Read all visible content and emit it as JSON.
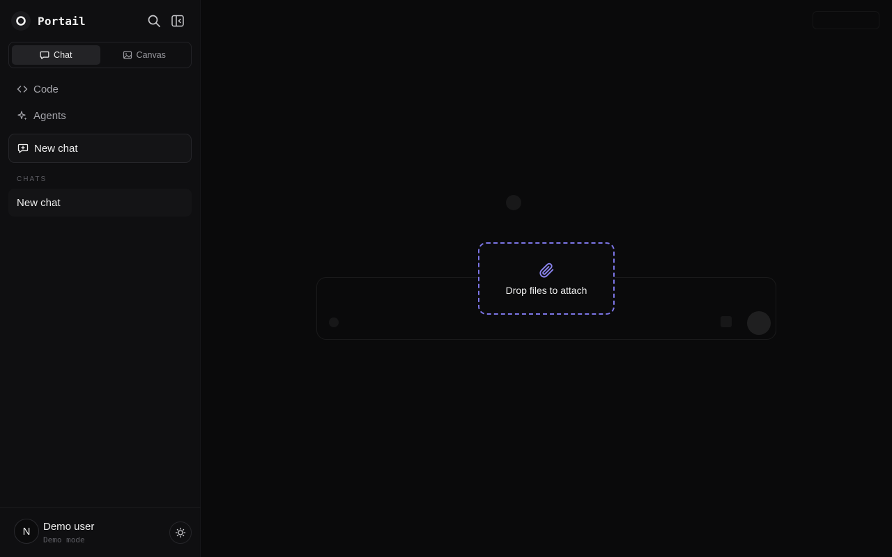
{
  "brand": {
    "name": "Portail"
  },
  "sidebar": {
    "icons": {
      "search": "search-icon",
      "collapse": "sidebar-collapse-icon"
    },
    "modes": [
      {
        "label": "Chat",
        "icon": "message-square-icon",
        "active": true
      },
      {
        "label": "Canvas",
        "icon": "image-icon",
        "active": false
      }
    ],
    "nav": [
      {
        "label": "Code",
        "icon": "code-icon"
      },
      {
        "label": "Agents",
        "icon": "sparkles-icon"
      }
    ],
    "new_chat_label": "New chat",
    "chats_section": "CHATS",
    "chats": [
      {
        "title": "New chat"
      }
    ],
    "user": {
      "initial": "N",
      "name": "Demo user",
      "subtitle": "Demo mode"
    },
    "theme_icon": "sun-icon"
  },
  "main": {
    "drop_overlay": {
      "label": "Drop files to attach",
      "icon": "paperclip-icon",
      "accent": "#7c75e6"
    }
  }
}
